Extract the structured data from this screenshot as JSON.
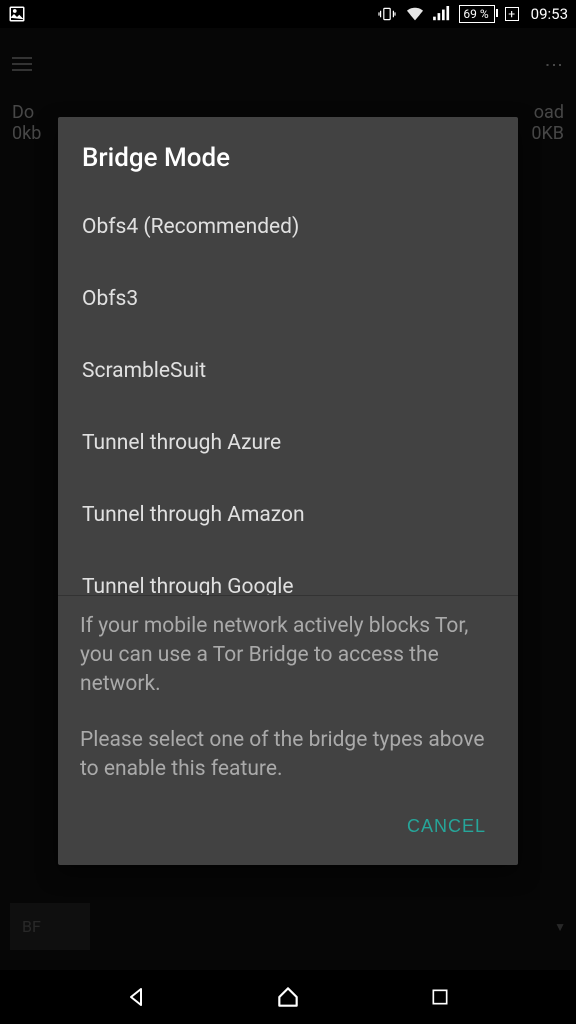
{
  "statusBar": {
    "battery": "69 %",
    "time": "09:53"
  },
  "background": {
    "stat_left_label": "Do",
    "stat_left_value": "0kb",
    "stat_right_label": "oad",
    "stat_right_value": "0KB",
    "bottom_label": "BF"
  },
  "dialog": {
    "title": "Bridge Mode",
    "options": [
      "Obfs4 (Recommended)",
      "Obfs3",
      "ScrambleSuit",
      "Tunnel through Azure",
      "Tunnel through Amazon",
      "Tunnel through Google"
    ],
    "description1": "If your mobile network actively blocks Tor, you can use a Tor Bridge to access the network.",
    "description2": "Please select one of the bridge types above to enable this feature.",
    "cancel": "CANCEL"
  }
}
